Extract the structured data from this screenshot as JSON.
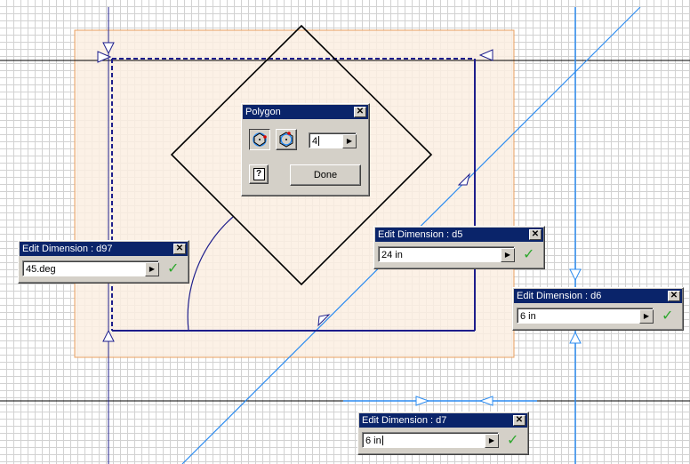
{
  "polygon_dialog": {
    "title": "Polygon",
    "close_icon": "close-x",
    "inscribed_icon": "polygon-inscribed-icon",
    "circumscribed_icon": "polygon-circumscribed-icon",
    "sides_value": "4",
    "help_icon": "help-icon",
    "help_label": "?",
    "done_label": "Done"
  },
  "dimensions": [
    {
      "title": "Edit Dimension : d97",
      "value": "45.deg"
    },
    {
      "title": "Edit Dimension : d5",
      "value": "24 in"
    },
    {
      "title": "Edit Dimension : d6",
      "value": "6 in"
    },
    {
      "title": "Edit Dimension : d7",
      "value": "6 in"
    }
  ],
  "glyphs": {
    "close": "✕",
    "dropdown": "▶",
    "accept": "✓"
  },
  "colors": {
    "grid": "#d2d2d2",
    "sketch_line": "#1e1e8c",
    "construction_line": "#2d8cf0",
    "shaded_region": "#fbeee2",
    "shaded_border": "#e8a060",
    "title_bar": "#0a246a",
    "accept_check": "#2ea82e"
  }
}
